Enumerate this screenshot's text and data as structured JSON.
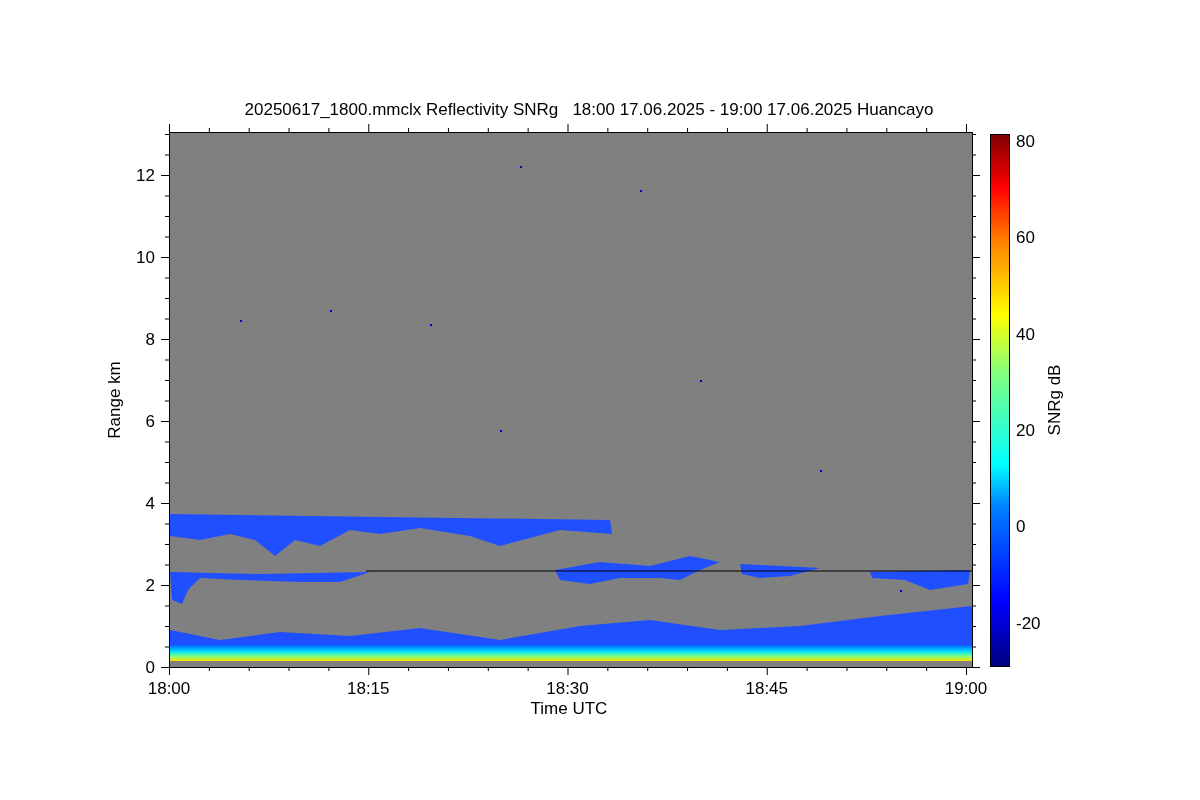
{
  "title": "20250617_1800.mmclx Reflectivity SNRg   18:00 17.06.2025 - 19:00 17.06.2025 Huancayo",
  "y_axis": {
    "label": "Range km",
    "ticks": [
      "12",
      "10",
      "8",
      "6",
      "4",
      "2",
      "0"
    ]
  },
  "x_axis": {
    "label": "Time UTC",
    "ticks": [
      "18:00",
      "18:15",
      "18:30",
      "18:45",
      "19:00"
    ]
  },
  "colorbar": {
    "label": "SNRg dB",
    "ticks": [
      "80",
      "60",
      "40",
      "20",
      "0",
      "-20"
    ]
  }
}
